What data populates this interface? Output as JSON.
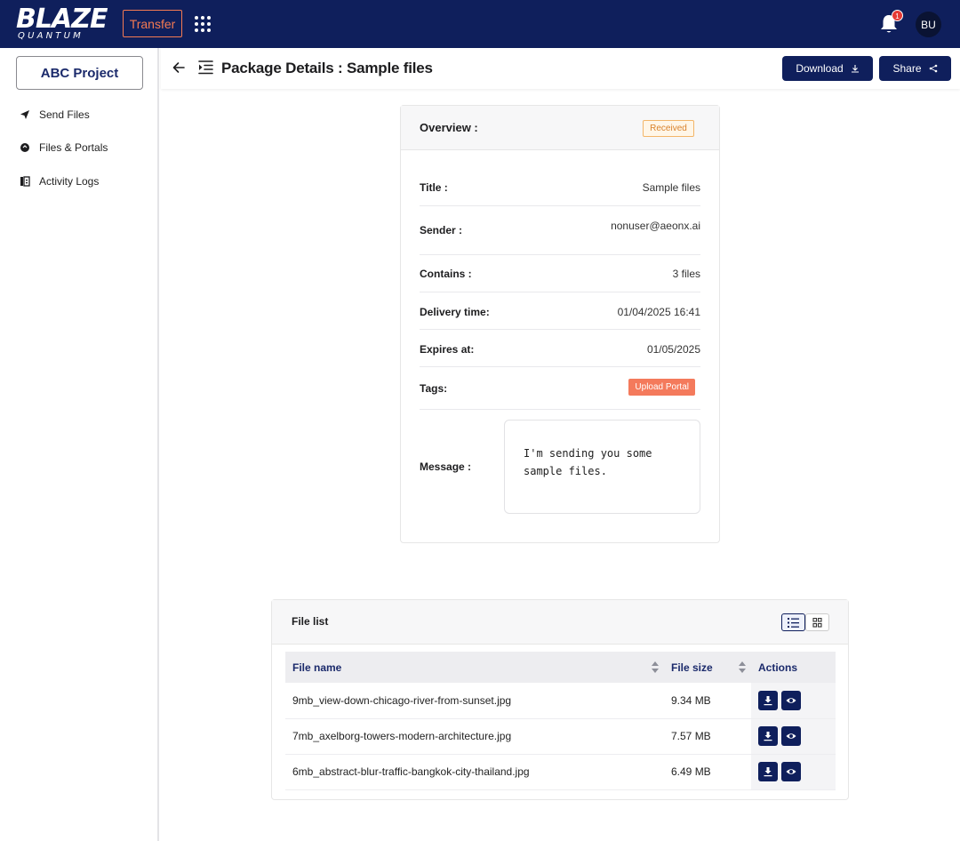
{
  "brand": {
    "name": "BLAZE",
    "sub": "QUANTUM"
  },
  "topbar": {
    "transfer_label": "Transfer",
    "notification_count": "1",
    "avatar_initials": "BU"
  },
  "sidebar": {
    "project": "ABC Project",
    "items": [
      {
        "label": "Send Files",
        "icon": "send-icon"
      },
      {
        "label": "Files & Portals",
        "icon": "files-icon"
      },
      {
        "label": "Activity Logs",
        "icon": "logs-icon"
      }
    ]
  },
  "header": {
    "title": "Package Details : Sample files",
    "download_label": "Download",
    "share_label": "Share"
  },
  "overview": {
    "title": "Overview :",
    "status": "Received",
    "fields": {
      "title_key": "Title :",
      "title_val": "Sample files",
      "sender_key": "Sender :",
      "sender_val": "nonuser@aeonx.ai",
      "contains_key": "Contains :",
      "contains_val": "3 files",
      "delivery_key": "Delivery time:",
      "delivery_val": "01/04/2025 16:41",
      "expires_key": "Expires at:",
      "expires_val": "01/05/2025",
      "tags_key": "Tags:",
      "tag": "Upload Portal",
      "message_key": "Message :",
      "message_val": "I'm sending you some sample files."
    },
    "colors": {
      "status": "#d9822b",
      "tag": "#f47a5c"
    }
  },
  "file_list": {
    "title": "File list",
    "columns": [
      "File name",
      "File size",
      "Actions"
    ],
    "rows": [
      {
        "name": "9mb_view-down-chicago-river-from-sunset.jpg",
        "size": "9.34 MB"
      },
      {
        "name": "7mb_axelborg-towers-modern-architecture.jpg",
        "size": "7.57 MB"
      },
      {
        "name": "6mb_abstract-blur-traffic-bangkok-city-thailand.jpg",
        "size": "6.49 MB"
      }
    ]
  },
  "theme": {
    "navy": "#0f1f5c",
    "accent": "#f47a52"
  }
}
